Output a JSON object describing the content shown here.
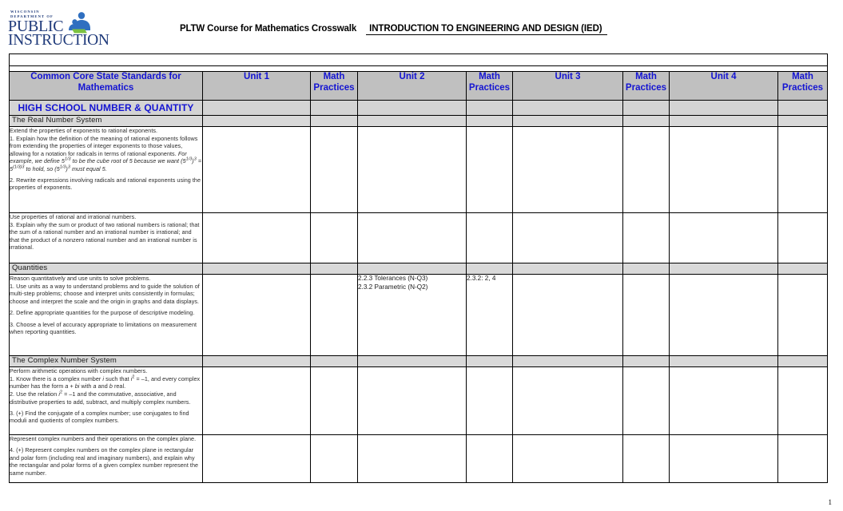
{
  "header": {
    "logo": {
      "line1": "WISCONSIN",
      "line2": "DEPARTMENT OF",
      "word1": "PUBLIC",
      "word2": "INSTRUCTION",
      "mark_name": "reading-figures-icon"
    },
    "title_main": "PLTW Course for Mathematics Crosswalk",
    "title_course": "INTRODUCTION TO ENGINEERING AND DESIGN (IED)"
  },
  "columns": {
    "ccss": "Common Core State Standards for Mathematics",
    "unit1": "Unit 1",
    "unit2": "Unit 2",
    "unit3": "Unit 3",
    "unit4": "Unit 4",
    "math_practices": "Math Practices"
  },
  "colors": {
    "header_text": "#1414d2",
    "header_fill": "#c0c0c0",
    "section_fill": "#d4d4d4",
    "domain_fill": "#d9d9d9"
  },
  "sections": [
    {
      "title": "HIGH SCHOOL NUMBER & QUANTITY",
      "domains": [
        {
          "name": "The Real Number System",
          "rows": [
            {
              "cluster": "Extend the properties of exponents to rational exponents.",
              "standards": [
                "1. Explain how the definition of the meaning of rational exponents follows from extending the properties of integer exponents to those values, allowing for a notation for radicals in terms of rational exponents.",
                "2. Rewrite expressions involving radicals and rational exponents using the properties of exponents."
              ],
              "example": "For example, we define 5 1/3 to be the cube root of 5 because we want (5 1/3 ) 3 = 5 (1/3)3 to hold, so (5 1/3 ) 3 must equal 5.",
              "unit1": "",
              "mp1": "",
              "unit2": "",
              "mp2": "",
              "unit3": "",
              "mp3": "",
              "unit4": "",
              "mp4": ""
            },
            {
              "cluster": "Use properties of rational and irrational numbers.",
              "standards": [
                "3. Explain why the sum or product of two rational numbers is rational; that the sum of a rational number and an irrational number is irrational; and that the product of a nonzero rational number and an irrational number is irrational."
              ],
              "unit1": "",
              "mp1": "",
              "unit2": "",
              "mp2": "",
              "unit3": "",
              "mp3": "",
              "unit4": "",
              "mp4": ""
            }
          ]
        },
        {
          "name": "Quantities",
          "rows": [
            {
              "cluster": "Reason quantitatively and use units to solve problems.",
              "standards": [
                "1. Use units as a way to understand problems and to guide the solution of multi-step problems; choose and interpret units consistently in formulas; choose and interpret the scale and the origin in graphs and data displays.",
                "2. Define appropriate quantities for the purpose of descriptive modeling.",
                "3. Choose a level of accuracy appropriate to limitations on measurement when reporting quantities."
              ],
              "unit1": "",
              "mp1": "",
              "unit2_lines": [
                "2.2.3 Tolerances (N-Q3)",
                "2.3.2 Parametric (N-Q2)"
              ],
              "mp2_lines": [
                "2.3.2:  2, 4"
              ],
              "unit3": "",
              "mp3": "",
              "unit4": "",
              "mp4": ""
            }
          ]
        },
        {
          "name": "The Complex Number System",
          "rows": [
            {
              "cluster": "Perform arithmetic operations with complex numbers.",
              "standards": [
                "1. Know there is a complex number i such that i 2 = –1, and every complex number has the form a + bi with a and b real.",
                "2. Use the relation i 2 = –1 and the commutative, associative, and distributive properties to add, subtract, and multiply complex numbers.",
                "3. (+) Find the conjugate of a complex number; use conjugates to find moduli and quotients of complex numbers."
              ],
              "unit1": "",
              "mp1": "",
              "unit2": "",
              "mp2": "",
              "unit3": "",
              "mp3": "",
              "unit4": "",
              "mp4": ""
            },
            {
              "cluster": "Represent complex numbers and their operations on the complex plane.",
              "standards": [
                "4. (+) Represent complex numbers on the complex plane in rectangular and polar form (including real and imaginary numbers), and explain why the rectangular and polar forms of a given complex number represent the same number."
              ],
              "unit1": "",
              "mp1": "",
              "unit2": "",
              "mp2": "",
              "unit3": "",
              "mp3": "",
              "unit4": "",
              "mp4": ""
            }
          ]
        }
      ]
    }
  ],
  "footer": {
    "page_number": "1"
  }
}
